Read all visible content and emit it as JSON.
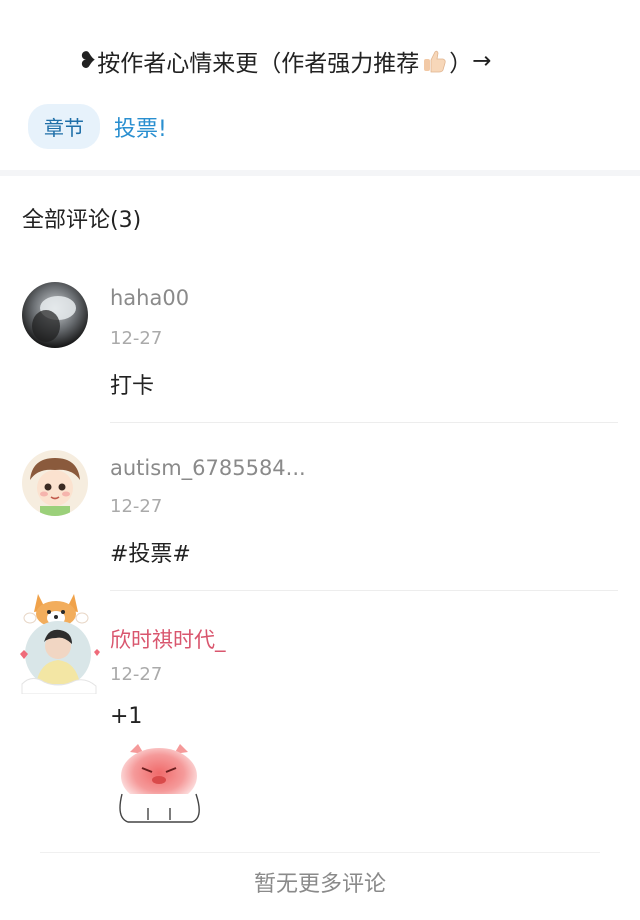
{
  "header": {
    "bullet": "❥",
    "text": "按作者心情来更（作者强力推荐",
    "close": "）",
    "arrow": "→",
    "thumb_icon": "thumbs-up-icon"
  },
  "tags": {
    "chapter": "章节",
    "vote": "投票!"
  },
  "comments_section": {
    "title": "全部评论(3)"
  },
  "comments": [
    {
      "username": "haha00",
      "date": "12-27",
      "text": "打卡"
    },
    {
      "username": "autism_6785584...",
      "date": "12-27",
      "text": "#投票#"
    },
    {
      "username": "欣时祺时代_",
      "date": "12-27",
      "text": "+1",
      "sticker": "blushing-pig-sticker"
    }
  ],
  "footer": {
    "text": "暂无更多评论"
  },
  "colors": {
    "accent": "#2a8fd0",
    "tag_bg": "#e7f2fb",
    "pink_username": "#d9566e",
    "muted": "#8a8a8a"
  }
}
